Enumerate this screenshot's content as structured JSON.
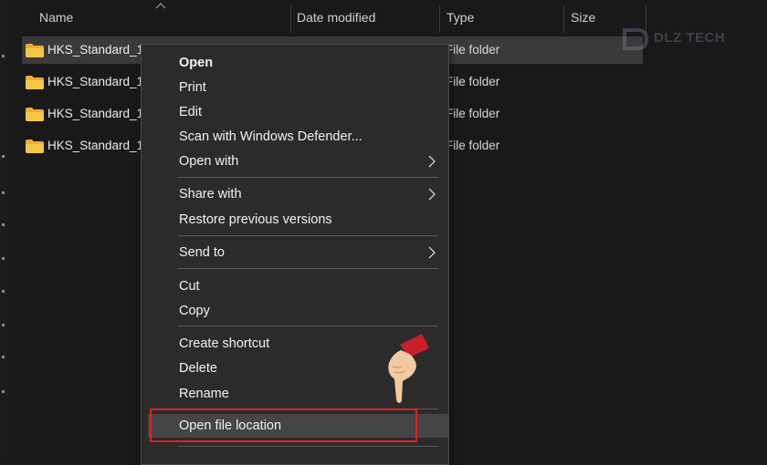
{
  "columns": {
    "name": "Name",
    "date_modified": "Date modified",
    "type": "Type",
    "size": "Size"
  },
  "files": [
    {
      "name": "HKS_Standard_1",
      "type": "File folder"
    },
    {
      "name": "HKS_Standard_1",
      "type": "File folder"
    },
    {
      "name": "HKS_Standard_1",
      "type": "File folder"
    },
    {
      "name": "HKS_Standard_1",
      "type": "File folder"
    }
  ],
  "watermark": {
    "text": "DLZ TECH"
  },
  "context_menu": {
    "open": "Open",
    "print": "Print",
    "edit": "Edit",
    "scan": "Scan with Windows Defender...",
    "open_with": "Open with",
    "share_with": "Share with",
    "restore": "Restore previous versions",
    "send_to": "Send to",
    "cut": "Cut",
    "copy": "Copy",
    "create_shortcut": "Create shortcut",
    "delete": "Delete",
    "rename": "Rename",
    "open_file_location": "Open file location"
  },
  "colors": {
    "background": "#191919",
    "menu_background": "#2b2b2b",
    "highlight_border": "#e02020",
    "folder": "#f0c040"
  }
}
